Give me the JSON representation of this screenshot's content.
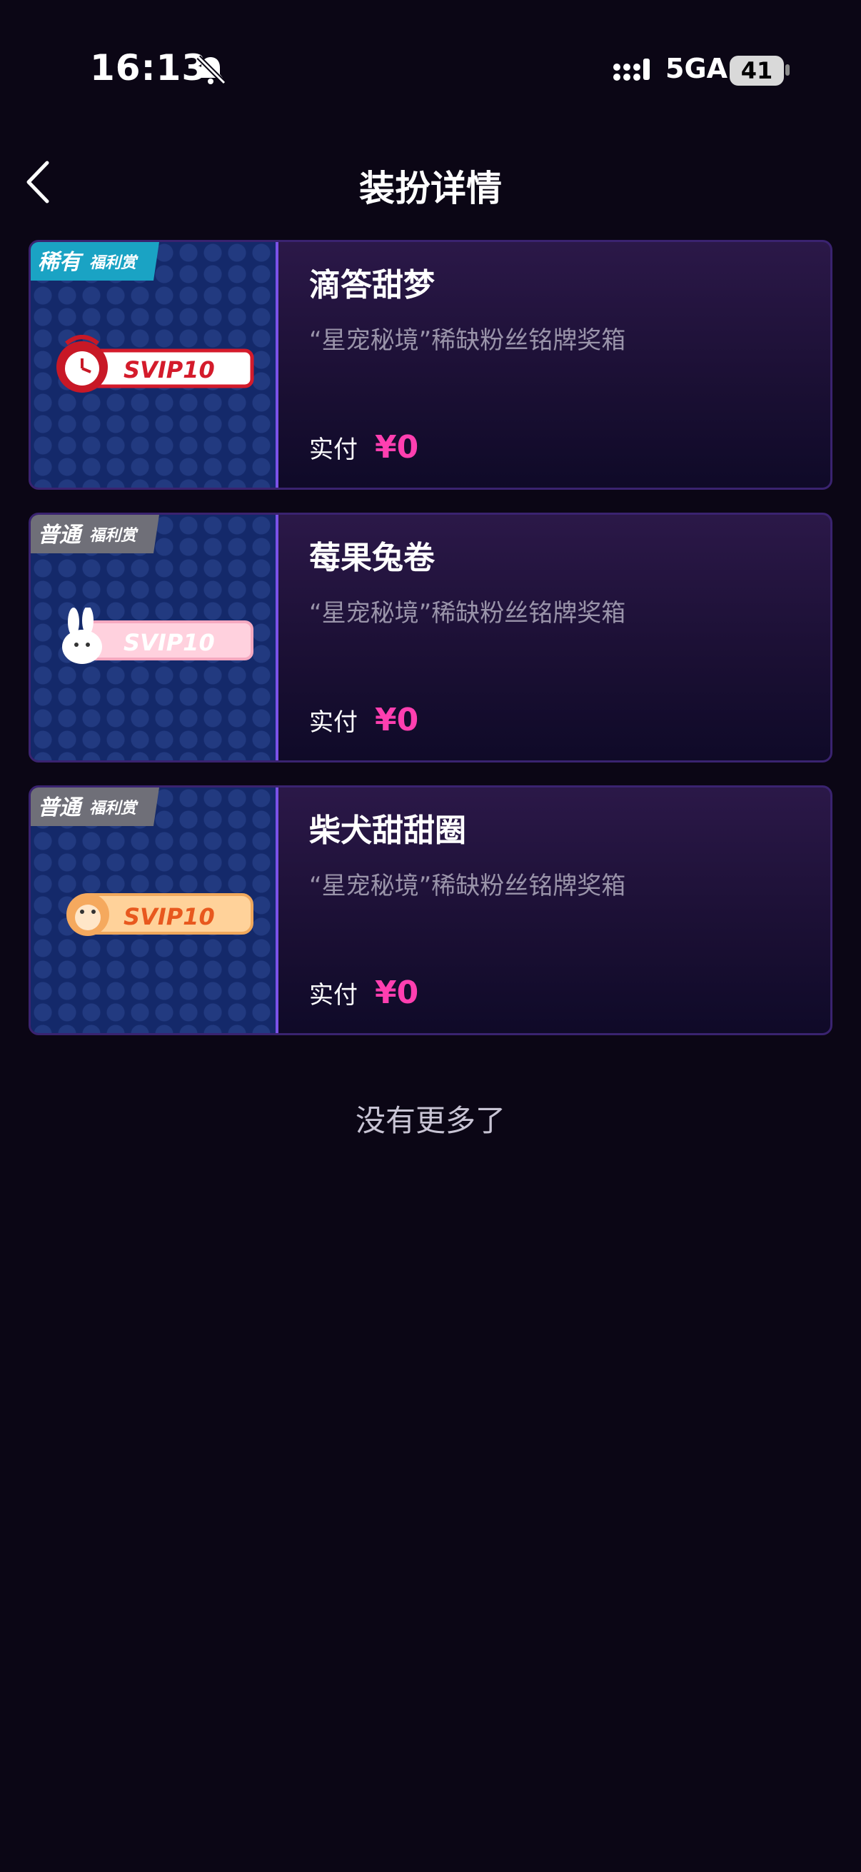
{
  "status": {
    "time": "16:13",
    "network": "5GA",
    "battery": "41"
  },
  "nav": {
    "title": "装扮详情"
  },
  "items": [
    {
      "badge_main": "稀有",
      "badge_sub": "福利赏",
      "badge_color": "#1aa3c4",
      "name": "滴答甜梦",
      "desc": "“星宠秘境”稀缺粉丝铭牌奖箱",
      "price_label": "实付",
      "price": "¥0",
      "plate_text": "SVIP10"
    },
    {
      "badge_main": "普通",
      "badge_sub": "福利赏",
      "badge_color": "#6f6f78",
      "name": "莓果兔卷",
      "desc": "“星宠秘境”稀缺粉丝铭牌奖箱",
      "price_label": "实付",
      "price": "¥0",
      "plate_text": "SVIP10"
    },
    {
      "badge_main": "普通",
      "badge_sub": "福利赏",
      "badge_color": "#6f6f78",
      "name": "柴犬甜甜圈",
      "desc": "“星宠秘境”稀缺粉丝铭牌奖箱",
      "price_label": "实付",
      "price": "¥0",
      "plate_text": "SVIP10"
    }
  ],
  "footer": {
    "no_more": "没有更多了"
  }
}
